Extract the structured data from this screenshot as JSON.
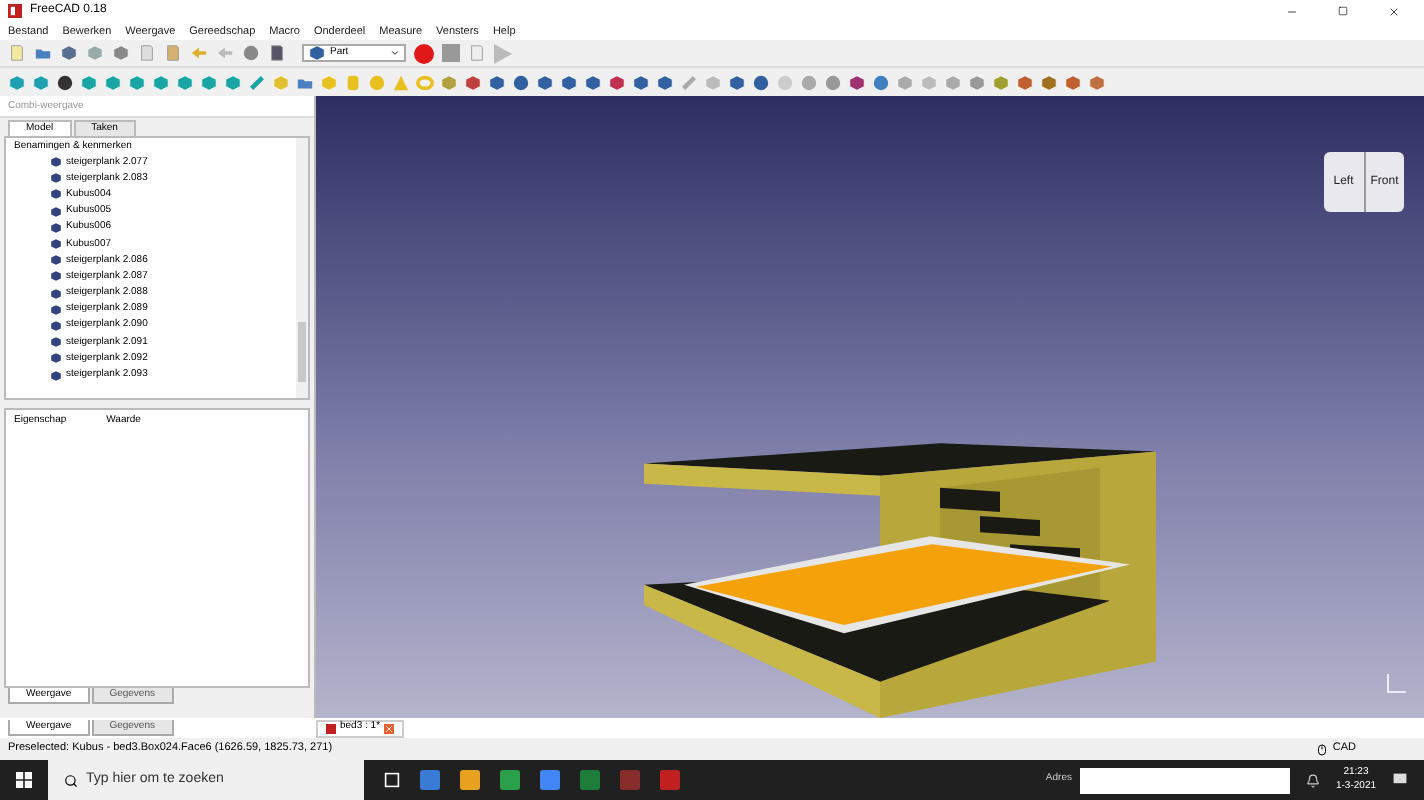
{
  "window": {
    "title": "FreeCAD 0.18"
  },
  "menu": [
    "Bestand",
    "Bewerken",
    "Weergave",
    "Gereedschap",
    "Macro",
    "Onderdeel",
    "Measure",
    "Vensters",
    "Help"
  ],
  "toolbar": {
    "workbench": "Part"
  },
  "combo_view": {
    "title": "Combi-weergave",
    "tabs": [
      {
        "label": "Model",
        "selected": true
      },
      {
        "label": "Taken",
        "selected": false
      }
    ],
    "tree_header": "Benamingen & kenmerken",
    "items": [
      "steigerplank 2.077",
      "steigerplank 2.083",
      "Kubus004",
      "Kubus005",
      "Kubus006",
      "Kubus007",
      "steigerplank 2.086",
      "steigerplank 2.087",
      "steigerplank 2.088",
      "steigerplank 2.089",
      "steigerplank 2.090",
      "steigerplank 2.091",
      "steigerplank 2.092",
      "steigerplank 2.093"
    ],
    "property_columns": [
      "Eigenschap",
      "Waarde"
    ],
    "property_tabs": [
      {
        "label": "Weergave",
        "selected": true
      },
      {
        "label": "Gegevens",
        "selected": false
      }
    ]
  },
  "bottom_tabs": [
    {
      "label": "Weergave",
      "selected": true
    },
    {
      "label": "Gegevens",
      "selected": false
    }
  ],
  "nav_cube": {
    "faces": [
      "Left",
      "Front"
    ]
  },
  "document_tab": {
    "label": "bed3 : 1*"
  },
  "status_bar": {
    "message": "Preselected: Kubus - bed3.Box024.Face6 (1626.59, 1825.73, 271)",
    "navigation": "CAD"
  },
  "taskbar": {
    "search_placeholder": "Typ hier om te zoeken",
    "address_label": "Adres",
    "time": "21:23",
    "date": "1-3-2021"
  }
}
